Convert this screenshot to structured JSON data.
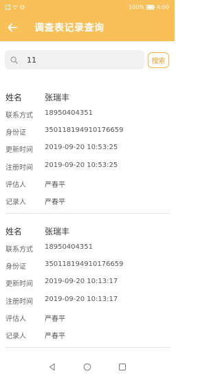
{
  "status_bar": {
    "battery": "100%",
    "time": "4:00"
  },
  "header": {
    "title": "调查表记录查询"
  },
  "search": {
    "value": "11",
    "button_label": "搜索"
  },
  "records": [
    {
      "fields": [
        {
          "label": "姓名",
          "value": "张瑞丰"
        },
        {
          "label": "联系方式",
          "value": "18950404351"
        },
        {
          "label": "身份证",
          "value": "350118194910176659"
        },
        {
          "label": "更新时间",
          "value": "2019-09-20 10:53:25"
        },
        {
          "label": "注册时间",
          "value": "2019-09-20 10:53:25"
        },
        {
          "label": "评估人",
          "value": "严春平"
        },
        {
          "label": "记录人",
          "value": "严春平"
        }
      ]
    },
    {
      "fields": [
        {
          "label": "姓名",
          "value": "张瑞丰"
        },
        {
          "label": "联系方式",
          "value": "18950404351"
        },
        {
          "label": "身份证",
          "value": "350118194910176659"
        },
        {
          "label": "更新时间",
          "value": "2019-09-20 10:13:17"
        },
        {
          "label": "注册时间",
          "value": "2019-09-20 10:13:17"
        },
        {
          "label": "评估人",
          "value": "严春平"
        },
        {
          "label": "记录人",
          "value": "严春平"
        }
      ]
    }
  ],
  "nav": {
    "icons": [
      "back-triangle-icon",
      "home-circle-icon",
      "recents-square-icon"
    ]
  },
  "colors": {
    "accent": "#f9bf58",
    "button_border": "#f4b43f"
  }
}
